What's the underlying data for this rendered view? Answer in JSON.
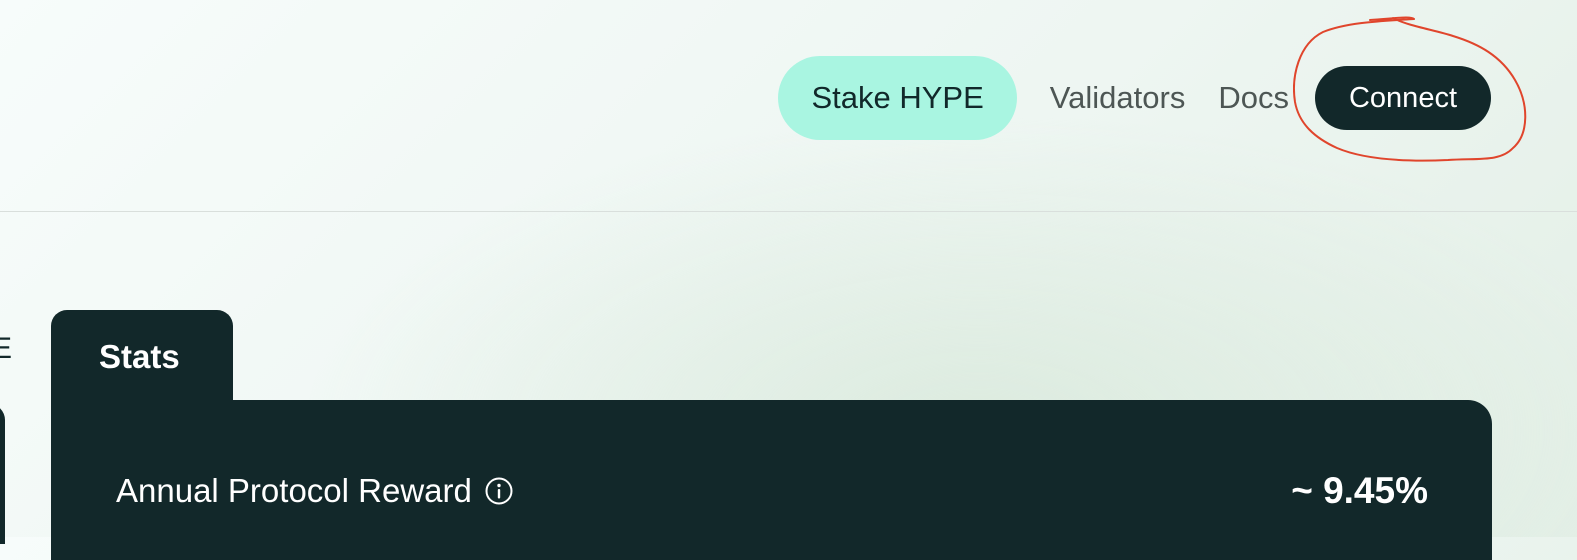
{
  "header": {
    "nav": {
      "stake_label": "Stake HYPE",
      "validators_label": "Validators",
      "docs_label": "Docs",
      "connect_label": "Connect"
    }
  },
  "edge": {
    "glyph": "E"
  },
  "stats": {
    "tab_label": "Stats",
    "rows": [
      {
        "label": "Annual Protocol Reward",
        "icon": "info-icon",
        "value": "~ 9.45%"
      }
    ]
  },
  "colors": {
    "dark": "#12282a",
    "accent_mint": "#a9f5e1",
    "annotation_red": "#e0452c"
  }
}
